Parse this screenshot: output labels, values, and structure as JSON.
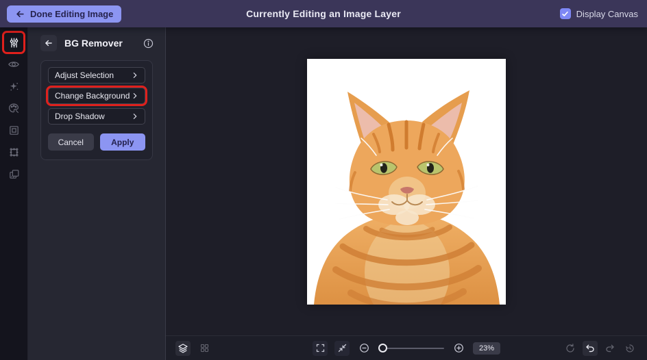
{
  "topbar": {
    "done_label": "Done Editing Image",
    "title": "Currently Editing an Image Layer",
    "display_canvas_label": "Display Canvas",
    "display_canvas_checked": true
  },
  "sidebar": {
    "icons": [
      {
        "name": "adjust-sliders-icon",
        "active": true,
        "annotated": true
      },
      {
        "name": "eye-icon",
        "active": false,
        "annotated": false
      },
      {
        "name": "sparkles-icon",
        "active": false,
        "annotated": false
      },
      {
        "name": "palette-icon",
        "active": false,
        "annotated": false
      },
      {
        "name": "frame-icon",
        "active": false,
        "annotated": false
      },
      {
        "name": "selection-icon",
        "active": false,
        "annotated": false
      },
      {
        "name": "duplicate-icon",
        "active": false,
        "annotated": false
      }
    ]
  },
  "panel": {
    "title": "BG Remover",
    "items": [
      {
        "label": "Adjust Selection",
        "annotated": false
      },
      {
        "label": "Change Background",
        "annotated": true
      },
      {
        "label": "Drop Shadow",
        "annotated": false
      }
    ],
    "cancel_label": "Cancel",
    "apply_label": "Apply"
  },
  "canvas": {
    "description": "orange tabby cat on white background"
  },
  "toolbar": {
    "zoom_percent": "23%",
    "icons_left": [
      "layers-icon",
      "grid-icon"
    ],
    "icons_center": [
      "fullscreen-icon",
      "fit-screen-icon",
      "zoom-out-icon",
      "zoom-slider",
      "zoom-in-icon"
    ],
    "icons_right": [
      "reset-icon",
      "undo-icon",
      "redo-icon",
      "history-icon"
    ],
    "active_left": "layers-icon",
    "active_right": "undo-icon"
  },
  "colors": {
    "accent": "#8C95F2",
    "topbar_bg": "#3B3659",
    "annotation_red": "#E0201C",
    "sidebar_bg": "#14141D",
    "panel_bg": "#262732",
    "canvas_bg": "#1E1E28",
    "artboard": "#FFFFFF"
  }
}
